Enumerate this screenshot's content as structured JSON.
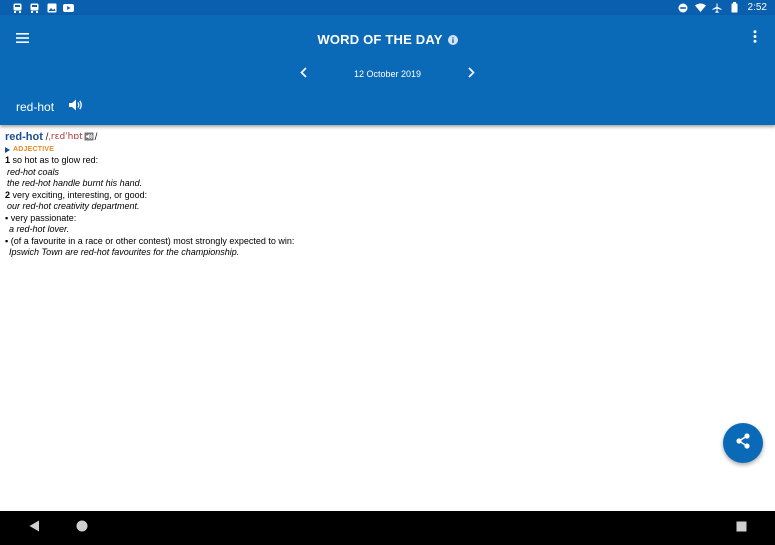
{
  "status_bar": {
    "left_icons": [
      "notification-app-icon",
      "notification-app-icon",
      "image-icon",
      "youtube-icon"
    ],
    "right_icons": [
      "do-not-disturb-icon",
      "wifi-icon",
      "airplane-icon",
      "battery-icon"
    ],
    "time": "2:52"
  },
  "header": {
    "title": "WORD OF THE DAY",
    "date": "12 October 2019",
    "word": "red-hot"
  },
  "entry": {
    "headword": "red-hot",
    "pronunciation": "ˌrɛdˈhɒt",
    "part_of_speech": "ADJECTIVE",
    "senses": [
      {
        "number": "1",
        "definition": "so hot as to glow red:",
        "examples": [
          "red-hot coals",
          "the red-hot handle burnt his hand."
        ]
      },
      {
        "number": "2",
        "definition": "very exciting, interesting, or good:",
        "examples": [
          "our red-hot creativity department."
        ],
        "subsenses": [
          {
            "definition": "very passionate:",
            "examples": [
              "a red-hot lover."
            ]
          },
          {
            "definition": "(of a favourite in a race or other contest) most strongly expected to win:",
            "examples": [
              "Ipswich Town are red-hot favourites for the championship."
            ]
          }
        ]
      }
    ]
  },
  "colors": {
    "header_blue": "#0a6ab8",
    "status_blue": "#0a5fae",
    "headword_blue": "#1a4e8c",
    "pos_orange": "#e58a2a",
    "pron_red": "#b0362c"
  }
}
